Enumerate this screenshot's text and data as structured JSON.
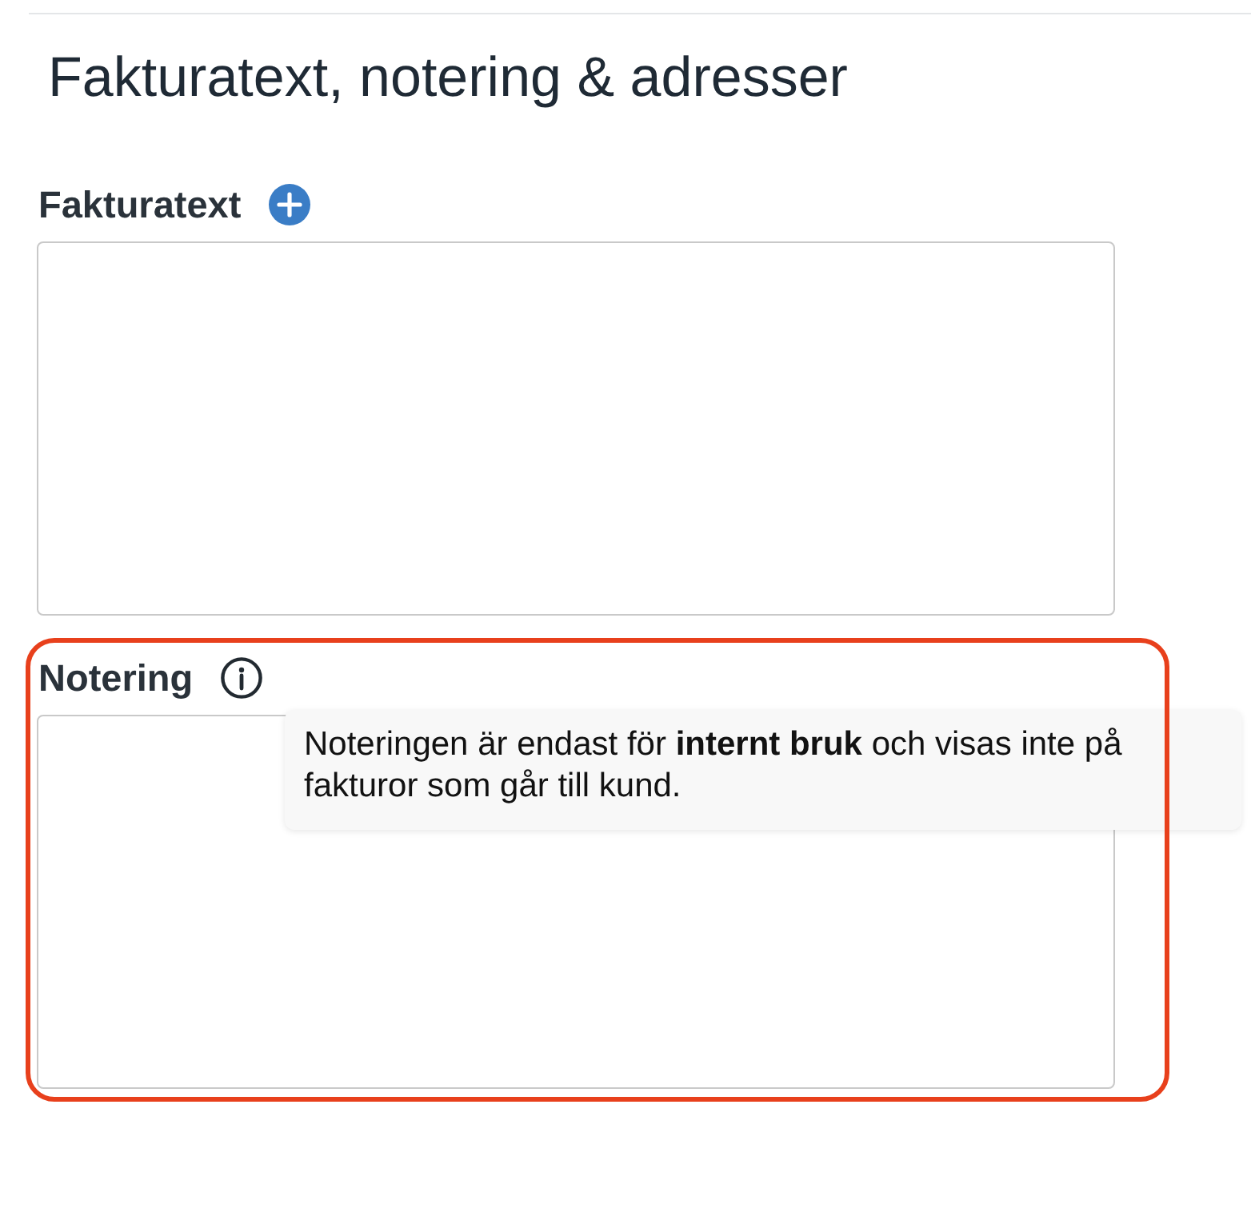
{
  "heading": "Fakturatext, notering & adresser",
  "fields": [
    {
      "label": "Fakturatext",
      "kind": "add",
      "highlighted": false
    },
    {
      "label": "Notering",
      "kind": "info",
      "highlighted": true,
      "tooltip": "Noteringen är endast för **internt bruk** och visas inte på fakturor som går till kund."
    }
  ]
}
